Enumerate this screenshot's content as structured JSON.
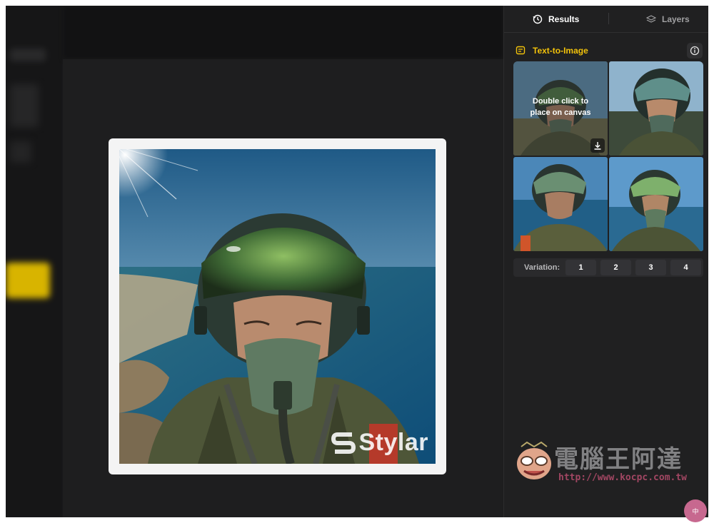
{
  "tabs": {
    "results_label": "Results",
    "layers_label": "Layers",
    "results_icon": "history-icon",
    "layers_icon": "layers-icon"
  },
  "section": {
    "title": "Text-to-Image",
    "title_icon": "prompt-icon",
    "info_icon": "info-icon"
  },
  "thumbnail_hover": {
    "line1": "Double click to",
    "line2": "place on canvas",
    "download_icon": "download-icon"
  },
  "variation": {
    "label": "Variation:",
    "options": [
      "1",
      "2",
      "3",
      "4"
    ]
  },
  "canvas": {
    "watermark": "Stylar"
  },
  "site_watermark": {
    "title": "電腦王阿達",
    "url": "http://www.kocpc.com.tw"
  },
  "corner_badge": "中",
  "colors": {
    "accent": "#f2c20a",
    "panel_bg": "#202021",
    "canvas_bg": "#1e1e1f"
  }
}
